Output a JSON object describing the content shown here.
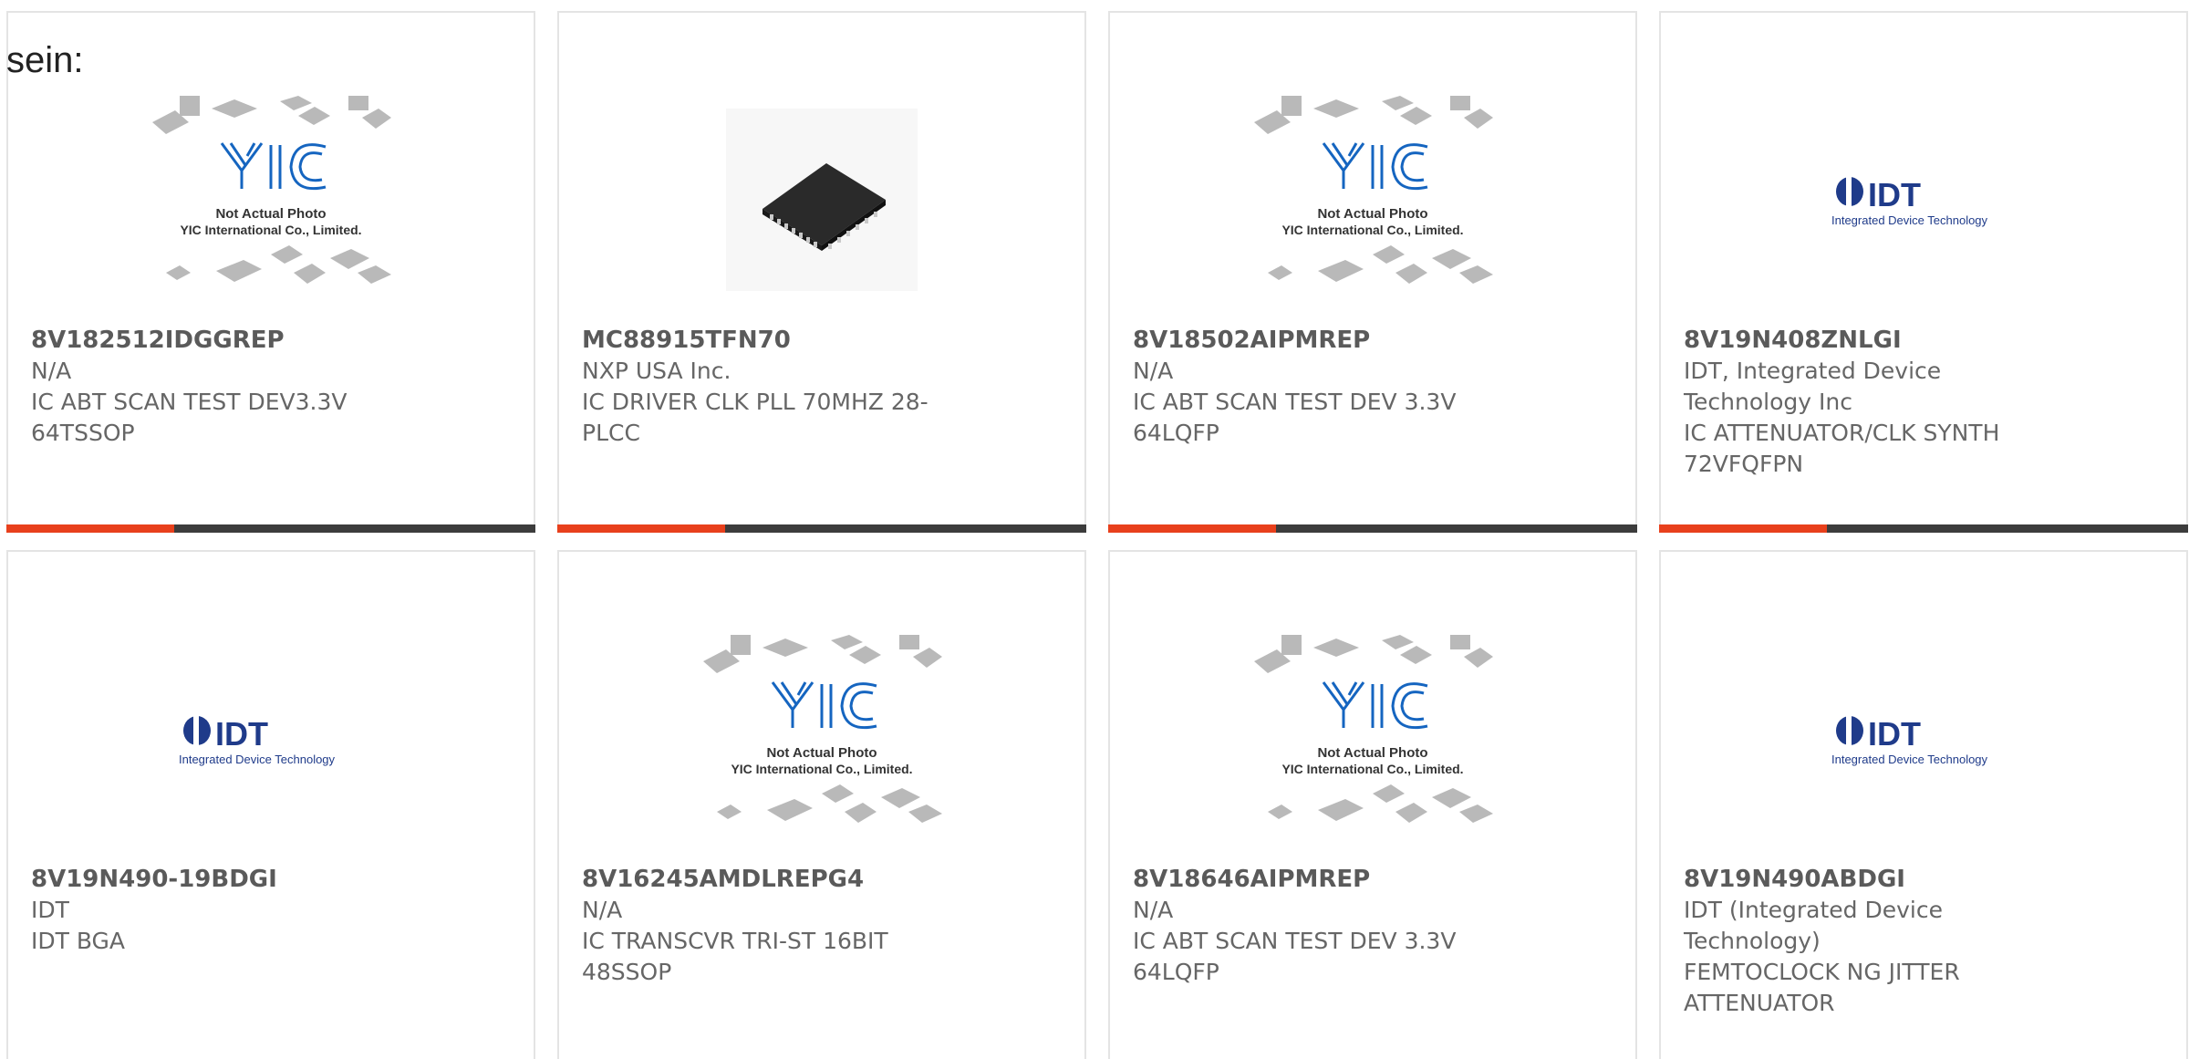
{
  "page": {
    "lead_text": "sein:"
  },
  "placeholder": {
    "logo_text": "YIC",
    "caption_line1": "Not Actual Photo",
    "caption_line2": "YIC International Co., Limited."
  },
  "idt_logo": {
    "wordmark": "IDT",
    "tagline": "Integrated Device Technology"
  },
  "colors": {
    "accent": "#e8401c",
    "bar": "#3c3c3c",
    "border": "#e4e4e4",
    "text": "#5a5a5a"
  },
  "products": [
    {
      "image": "yic-placeholder",
      "part_number": "8V182512IDGGREP",
      "manufacturer": "N/A",
      "description": "IC ABT SCAN TEST DEV3.3V 64TSSOP"
    },
    {
      "image": "plcc-chip-photo",
      "part_number": "MC88915TFN70",
      "manufacturer": "NXP USA Inc.",
      "description": "IC DRIVER CLK PLL 70MHZ 28-PLCC"
    },
    {
      "image": "yic-placeholder",
      "part_number": "8V18502AIPMREP",
      "manufacturer": "N/A",
      "description": "IC ABT SCAN TEST DEV 3.3V 64LQFP"
    },
    {
      "image": "idt-logo",
      "part_number": "8V19N408ZNLGI",
      "manufacturer": "IDT, Integrated Device Technology Inc",
      "description": "IC ATTENUATOR/CLK SYNTH 72VFQFPN"
    },
    {
      "image": "idt-logo",
      "part_number": "8V19N490-19BDGI",
      "manufacturer": "IDT",
      "description": "IDT BGA"
    },
    {
      "image": "yic-placeholder",
      "part_number": "8V16245AMDLREPG4",
      "manufacturer": "N/A",
      "description": "IC TRANSCVR TRI-ST 16BIT 48SSOP"
    },
    {
      "image": "yic-placeholder",
      "part_number": "8V18646AIPMREP",
      "manufacturer": "N/A",
      "description": "IC ABT SCAN TEST DEV 3.3V 64LQFP"
    },
    {
      "image": "idt-logo",
      "part_number": "8V19N490ABDGI",
      "manufacturer": "IDT (Integrated Device Technology)",
      "description": "FEMTOCLOCK NG JITTER ATTENUATOR"
    }
  ]
}
